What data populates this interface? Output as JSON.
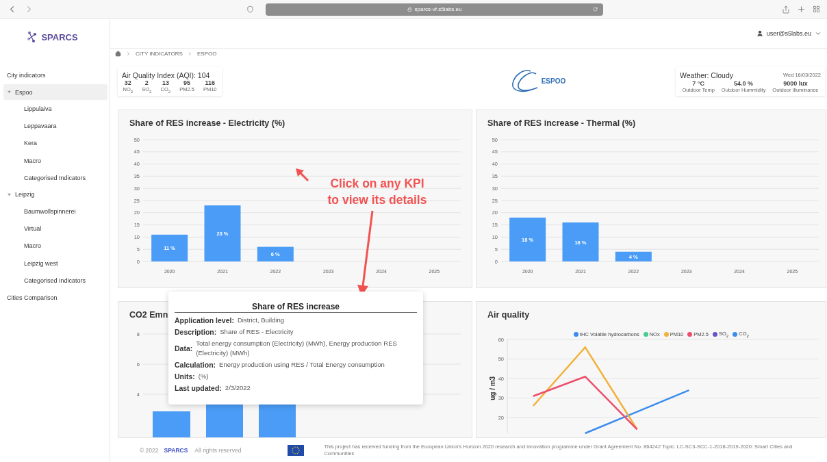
{
  "browser": {
    "url": "sparcs-vf.s5labs.eu"
  },
  "sidebar": {
    "logo": "SPARCS",
    "section": "City indicators",
    "cities": [
      {
        "name": "Espoo",
        "expanded": true,
        "selected": true,
        "children": [
          {
            "name": "Lippulaiva"
          },
          {
            "name": "Leppavaara"
          },
          {
            "name": "Kera"
          },
          {
            "name": "Macro"
          },
          {
            "name": "Categorised Indicators"
          }
        ]
      },
      {
        "name": "Leipzig",
        "expanded": true,
        "selected": false,
        "children": [
          {
            "name": "Baumwollspinnerei"
          },
          {
            "name": "Virtual"
          },
          {
            "name": "Macro"
          },
          {
            "name": "Leipzig west"
          },
          {
            "name": "Categorised Indicators"
          }
        ]
      }
    ],
    "bottom_item": "Cities Comparison"
  },
  "header": {
    "user": "user@s5labs.eu"
  },
  "breadcrumb": [
    "CITY INDICATORS",
    "ESPOO"
  ],
  "aqi": {
    "title": "Air Quality Index (AQI): 104",
    "readings": [
      {
        "value": "32",
        "label": "NO$_{2}$"
      },
      {
        "value": "2",
        "label": "SO$_{2}$"
      },
      {
        "value": "13",
        "label": "CO$_{2}$"
      },
      {
        "value": "95",
        "label": "PM2.5"
      },
      {
        "value": "116",
        "label": "PM10"
      }
    ]
  },
  "city_logo": "ESPOO",
  "weather": {
    "title": "Weather: Cloudy",
    "date": "Wed 16/03/2022",
    "readings": [
      {
        "value": "7 °C",
        "label": "Outdoor Temp"
      },
      {
        "value": "54.0 %",
        "label": "Outdoor Hummidity"
      },
      {
        "value": "9000 lux",
        "label": "Outdoor Illuminance"
      }
    ]
  },
  "charts": [
    {
      "title": "Share of RES increase - Electricity (%)",
      "chart_data": {
        "type": "bar",
        "categories": [
          "2020",
          "2021",
          "2022",
          "2023",
          "2024",
          "2025"
        ],
        "values": [
          11,
          23,
          6,
          null,
          null,
          null
        ],
        "value_labels": [
          "11 %",
          "23 %",
          "6 %",
          null,
          null,
          null
        ],
        "grid": true,
        "ylim": [
          0,
          50
        ],
        "yticks": [
          0,
          5,
          10,
          15,
          20,
          25,
          30,
          35,
          40,
          45,
          50
        ]
      }
    },
    {
      "title": "Share of RES increase - Thermal (%)",
      "chart_data": {
        "type": "bar",
        "categories": [
          "2020",
          "2021",
          "2022",
          "2023",
          "2024",
          "2025"
        ],
        "values": [
          18,
          16,
          4,
          null,
          null,
          null
        ],
        "value_labels": [
          "18 %",
          "16 %",
          "4 %",
          null,
          null,
          null
        ],
        "grid": true,
        "ylim": [
          0,
          50
        ],
        "yticks": [
          0,
          5,
          10,
          15,
          20,
          25,
          30,
          35,
          40,
          45,
          50
        ]
      }
    }
  ],
  "co2_card": {
    "title": "CO2 Emn",
    "y_ticks": [
      "8",
      "6",
      "4"
    ]
  },
  "air_quality": {
    "title": "Air quality",
    "chart_data": {
      "type": "line",
      "ylabel": "ug / m3",
      "grid": true,
      "categories": [
        null,
        null,
        null,
        null,
        null,
        null
      ],
      "ylim": [
        12,
        60
      ],
      "yticks": [
        20,
        30,
        40,
        50,
        60
      ],
      "series": [
        {
          "name": "tHC Volatile hydrocarbons",
          "color": "#3b8ced",
          "values": [
            null,
            12,
            23,
            34,
            null,
            null
          ]
        },
        {
          "name": "NOx",
          "color": "#3fcf8e",
          "values": [
            null,
            null,
            null,
            null,
            null,
            null
          ]
        },
        {
          "name": "PM10",
          "color": "#f2b13a",
          "values": [
            26,
            56,
            14,
            null,
            null,
            null
          ]
        },
        {
          "name": "PM2.5",
          "color": "#ee4d6a",
          "values": [
            31,
            41,
            14,
            null,
            null,
            null
          ]
        },
        {
          "name": "SO$_{2}$",
          "color": "#6a52c9",
          "values": [
            null,
            null,
            null,
            null,
            null,
            null
          ]
        },
        {
          "name": "CO$_{2}$",
          "color": "#3b8ced",
          "values": [
            null,
            null,
            null,
            null,
            null,
            null
          ]
        }
      ]
    }
  },
  "tooltip": {
    "title": "Share of RES increase",
    "rows": [
      {
        "label": "Application level:",
        "value": "District, Building"
      },
      {
        "label": "Description:",
        "value": "Share of RES - Electricity"
      },
      {
        "label": "Data:",
        "value": "Total energy consumption (Electricity) (MWh), Energy production RES (Electricity) (MWh)"
      },
      {
        "label": "Calculation:",
        "value": "Energy production using RES / Total Energy consumption"
      },
      {
        "label": "Units:",
        "value": "(%)"
      },
      {
        "label": "Last updated:",
        "value": "2/3/2022"
      }
    ]
  },
  "annotation": {
    "text": "Click on any KPI to view its details"
  },
  "footer": {
    "year": "© 2022",
    "brand": "SPARCS",
    "rights": "All rights reserved",
    "funding": "This project has received funding from the European Union's Horizon 2020 research and innovation programme under Grant Agreement No. 864242 Topic: LC-SC3-SCC-1-2018-2019-2020: Smart Cities and Communities"
  }
}
